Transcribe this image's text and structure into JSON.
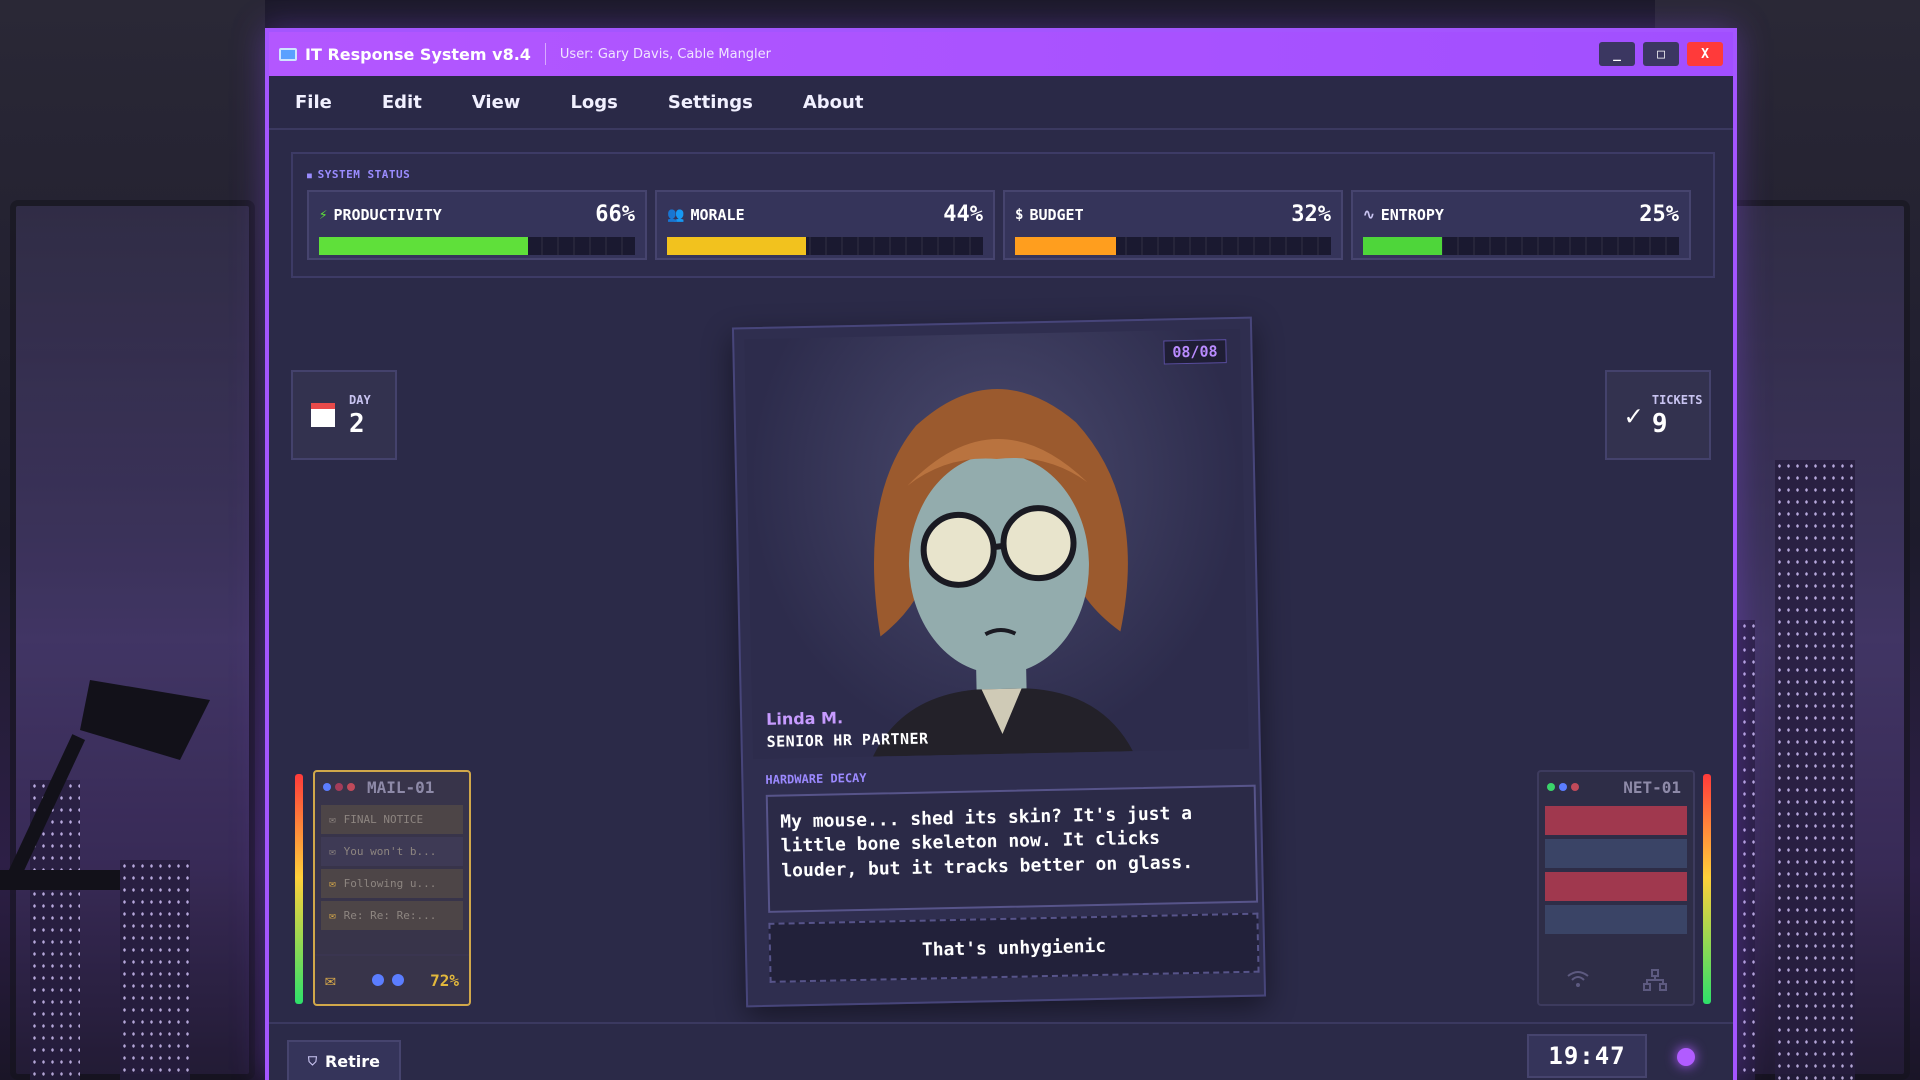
{
  "window": {
    "title": "IT Response System v8.4",
    "user": "User: Gary Davis, Cable Mangler",
    "controls": {
      "minimize": "_",
      "maximize": "□",
      "close": "X"
    }
  },
  "menu": [
    "File",
    "Edit",
    "View",
    "Logs",
    "Settings",
    "About"
  ],
  "status": {
    "title": "SYSTEM STATUS",
    "stats": [
      {
        "name": "PRODUCTIVITY",
        "value": "66%",
        "level": 66,
        "color": "#5fe03a",
        "icon": "lightning-icon"
      },
      {
        "name": "MORALE",
        "value": "44%",
        "level": 44,
        "color": "#f2c21e",
        "icon": "people-icon"
      },
      {
        "name": "BUDGET",
        "value": "32%",
        "level": 32,
        "color": "#ff9e1e",
        "icon": "dollar-icon"
      },
      {
        "name": "ENTROPY",
        "value": "25%",
        "level": 25,
        "color": "#4ed63a",
        "icon": "pulse-icon"
      }
    ]
  },
  "day": {
    "label": "DAY",
    "value": "2"
  },
  "tickets": {
    "label": "TICKETS",
    "value": "9"
  },
  "card": {
    "counter": "08/08",
    "name": "Linda M.",
    "role": "SENIOR HR PARTNER",
    "issue_label": "HARDWARE DECAY",
    "issue_text": "My mouse... shed its skin? It's just a little bone skeleton now. It clicks louder, but it tracks better on glass.",
    "reply": "That's unhygienic"
  },
  "mail": {
    "name": "MAIL-01",
    "items": [
      "FINAL NOTICE",
      "You won't b...",
      "Following u...",
      "Re: Re: Re:..."
    ],
    "percent": "72%"
  },
  "net": {
    "name": "NET-01"
  },
  "bottom": {
    "retire": "Retire",
    "clock": "19:47"
  },
  "colors": {
    "accent": "#a455ff",
    "close": "#ff3a3a"
  }
}
